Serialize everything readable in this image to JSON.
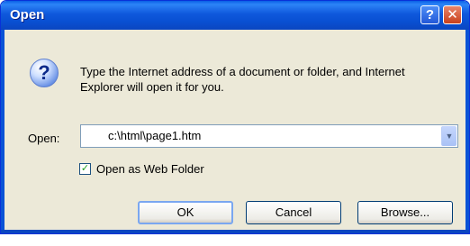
{
  "window": {
    "title": "Open",
    "help_glyph": "?",
    "close_glyph": "✕"
  },
  "dialog": {
    "icon": "question-icon",
    "icon_glyph": "?",
    "message": "Type the Internet address of a document or folder, and Internet Explorer will open it for you.",
    "open_label": "Open:",
    "address_value": "c:\\html\\page1.htm",
    "dropdown_glyph": "▼",
    "checkbox": {
      "label": "Open as Web Folder",
      "checked": true,
      "glyph": "✓"
    }
  },
  "buttons": {
    "ok": "OK",
    "cancel": "Cancel",
    "browse": "Browse..."
  },
  "colors": {
    "titlebar": "#0950d3",
    "dialog_bg": "#ece9d8",
    "close_button": "#c9401c"
  }
}
